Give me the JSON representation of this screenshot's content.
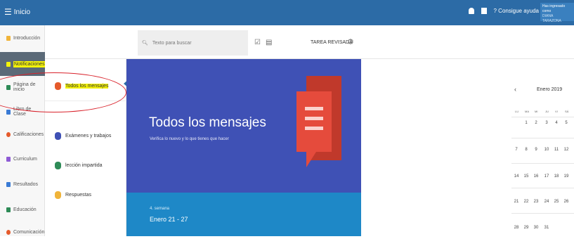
{
  "topbar": {
    "menu_label": "Inicio",
    "help_label": "Consigue ayuda",
    "user_line1": "Has ingresado como",
    "user_line2": "DIANA TARAZONA"
  },
  "sidebar": {
    "items": [
      {
        "label": "Introducción",
        "color": "#f0b43a"
      },
      {
        "label": "Notificaciones",
        "color": "#f4f30a"
      },
      {
        "label": "Página de inicio",
        "color": "#2e8b57"
      },
      {
        "label": "Libro de Clase",
        "color": "#3a7bd5"
      },
      {
        "label": "Calificaciones",
        "color": "#e55a2b"
      },
      {
        "label": "Curriculum",
        "color": "#8e5bd5"
      },
      {
        "label": "Resultados",
        "color": "#3a7bd5"
      },
      {
        "label": "Educación",
        "color": "#2e8b57"
      },
      {
        "label": "Comunicación",
        "color": "#e55a2b"
      }
    ]
  },
  "search": {
    "placeholder": "Texto para buscar"
  },
  "toolbar": {
    "status_label": "TAREA REVISADA"
  },
  "messages": {
    "items": [
      {
        "label": "Todos los mensajes",
        "color": "#e55a2b"
      },
      {
        "label": "Exámenes y trabajos",
        "color": "#3f51b5"
      },
      {
        "label": "lección impartida",
        "color": "#2e8b57"
      },
      {
        "label": "Respuestas",
        "color": "#f0b43a"
      }
    ]
  },
  "hero": {
    "title": "Todos los mensajes",
    "subtitle": "Verifica lo nuevo y lo que tienes que hacer",
    "week": "4. semana",
    "range": "Enero 21 - 27"
  },
  "calendar": {
    "prev": "‹",
    "month": "Enero 2019",
    "dow": [
      "LU",
      "MA",
      "MI",
      "JU",
      "VI",
      "SÁ"
    ],
    "rows": [
      [
        "",
        "1",
        "2",
        "3",
        "4",
        "5"
      ],
      [
        "7",
        "8",
        "9",
        "10",
        "11",
        "12"
      ],
      [
        "14",
        "15",
        "16",
        "17",
        "18",
        "19"
      ],
      [
        "21",
        "22",
        "23",
        "24",
        "25",
        "26"
      ],
      [
        "28",
        "29",
        "30",
        "31",
        "",
        ""
      ]
    ]
  }
}
